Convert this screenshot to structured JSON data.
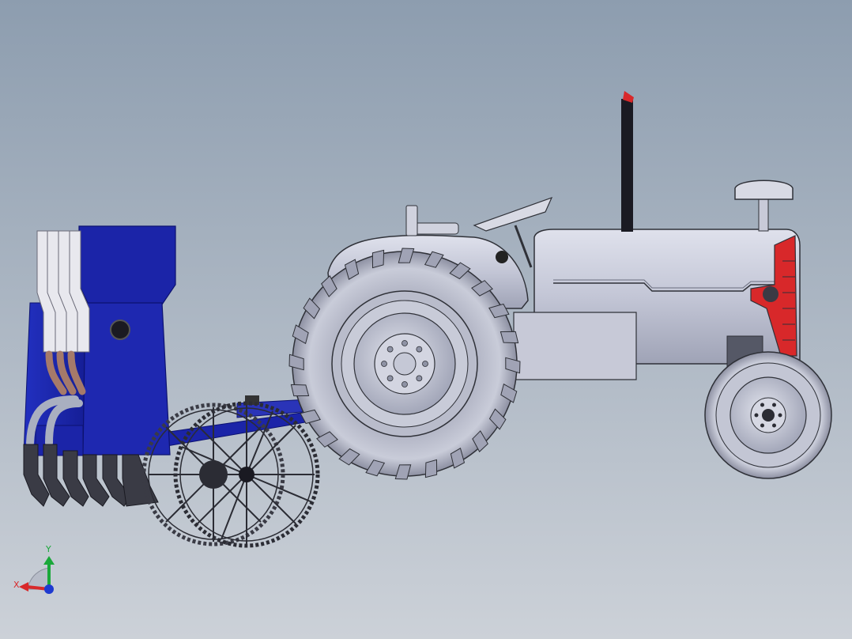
{
  "background": {
    "top_color": "#8d9daf",
    "bottom_color": "#ccd1d8"
  },
  "colors": {
    "tractor_body": "#c2c6d6",
    "tractor_outline": "#2f3138",
    "tire": "#b9bccb",
    "tire_dark": "#7d8092",
    "seeder_blue": "#1b24a8",
    "seeder_blue_dark": "#0c1270",
    "seed_tube_white": "#e6e6ea",
    "hose_copper": "#a07a6a",
    "hose_gray": "#9aa0b0",
    "opener_dark": "#3a3b45",
    "accent_red": "#d8282a",
    "axis_x": "#d8282a",
    "axis_y": "#1aa83a",
    "axis_z": "#1e3ad0"
  },
  "triad": {
    "x_label": "X",
    "y_label": "Y"
  }
}
